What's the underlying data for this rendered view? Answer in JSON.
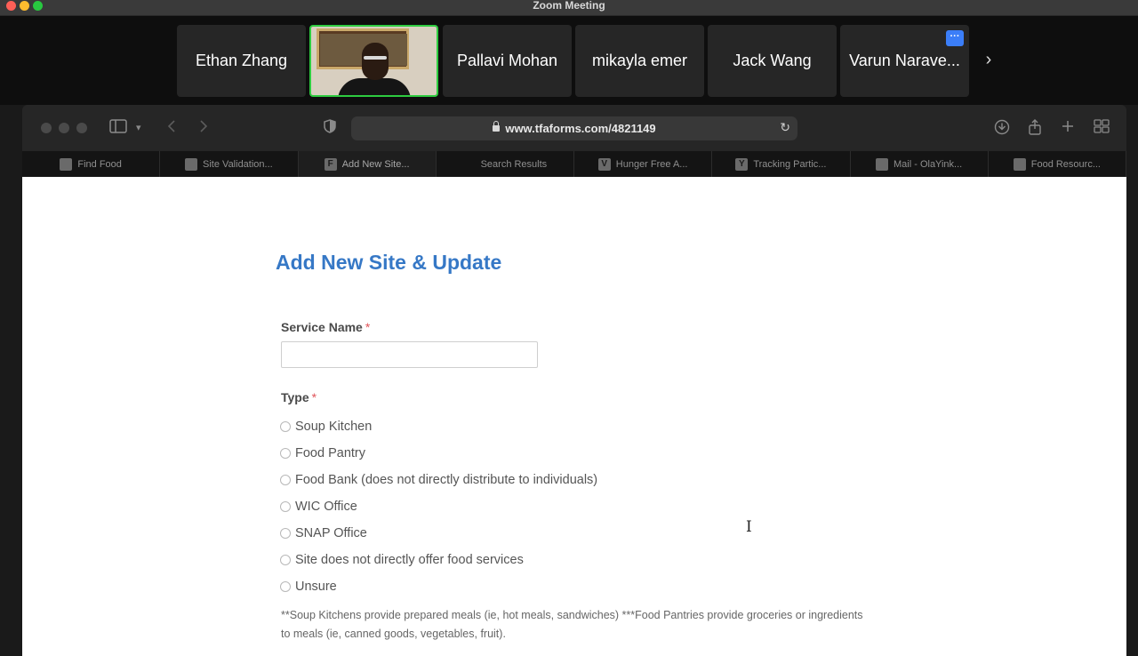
{
  "zoom": {
    "window_title": "Zoom Meeting",
    "participants": [
      {
        "name": "Ethan Zhang"
      },
      {
        "name": ""
      },
      {
        "name": "Pallavi Mohan"
      },
      {
        "name": "mikayla emer"
      },
      {
        "name": "Jack Wang"
      },
      {
        "name": "Varun Narave..."
      }
    ],
    "more_label": "···",
    "next_label": "›"
  },
  "browser": {
    "url": "www.tfaforms.com/4821149",
    "tabs": [
      {
        "label": "Find Food",
        "icon": ""
      },
      {
        "label": "Site Validation...",
        "icon": ""
      },
      {
        "label": "Add New Site...",
        "icon": "F"
      },
      {
        "label": "Search Results",
        "icon": ""
      },
      {
        "label": "Hunger Free A...",
        "icon": "V"
      },
      {
        "label": "Tracking Partic...",
        "icon": "Y"
      },
      {
        "label": "Mail - OlaYink...",
        "icon": ""
      },
      {
        "label": "Food Resourc...",
        "icon": ""
      }
    ]
  },
  "form": {
    "title": "Add New Site & Update",
    "service_name_label": "Service Name",
    "service_name_value": "",
    "type_label": "Type",
    "required_mark": "*",
    "type_options": [
      "Soup Kitchen",
      "Food Pantry",
      "Food Bank (does not directly distribute to individuals)",
      "WIC Office",
      "SNAP Office",
      "Site does not directly offer food services",
      "Unsure"
    ],
    "footnote": "**Soup Kitchens provide prepared meals (ie, hot meals, sandwiches) ***Food Pantries provide groceries or ingredients to meals (ie, canned goods, vegetables, fruit)."
  }
}
